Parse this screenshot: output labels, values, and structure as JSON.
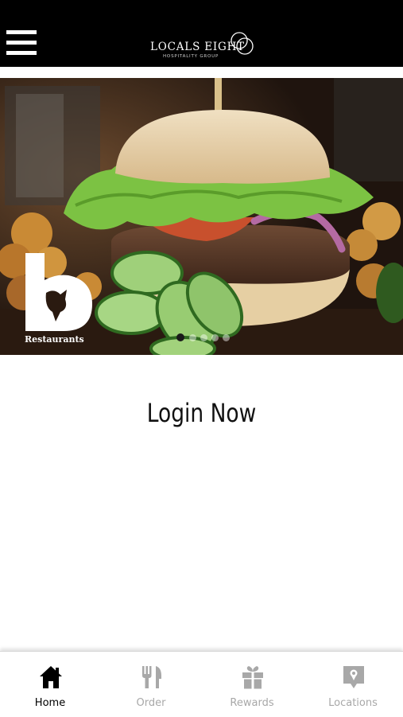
{
  "header": {
    "menu_icon": "hamburger-menu-icon",
    "logo_name": "LOCALS EIGHT",
    "logo_tagline": "HOSPITALITY GROUP"
  },
  "hero": {
    "image": "burger-with-cucumbers-photo",
    "brand_word": "Restaurants",
    "slide_count": 5,
    "active_slide": 1
  },
  "main": {
    "login_label": "Login Now"
  },
  "tabbar": {
    "items": [
      {
        "label": "Home",
        "icon": "home-icon",
        "active": true
      },
      {
        "label": "Order",
        "icon": "fork-knife-icon",
        "active": false
      },
      {
        "label": "Rewards",
        "icon": "gift-icon",
        "active": false
      },
      {
        "label": "Locations",
        "icon": "map-pin-icon",
        "active": false
      }
    ]
  },
  "colors": {
    "header_bg": "#000000",
    "active_tab": "#000000",
    "inactive_tab": "#a8a8a8"
  }
}
